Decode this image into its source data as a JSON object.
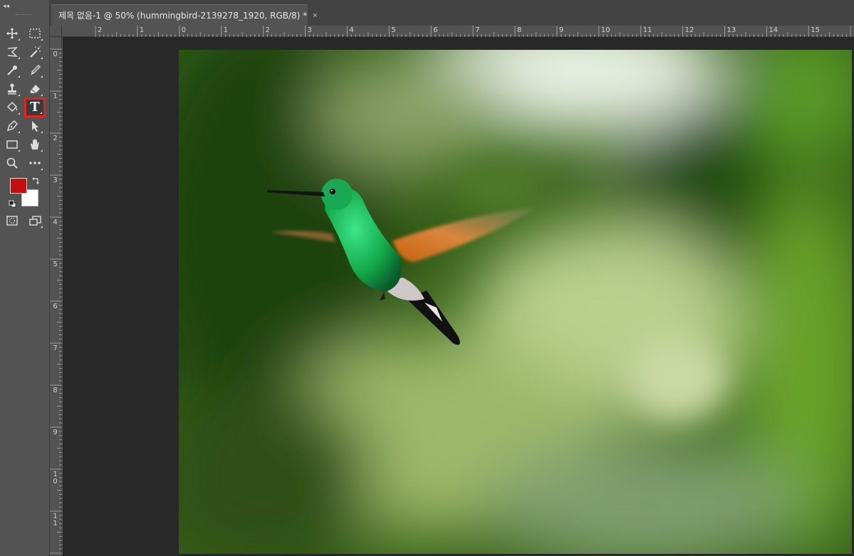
{
  "toolbar": {
    "collapse_label": "◂◂",
    "tools": [
      {
        "id": "move",
        "icon": "move-icon"
      },
      {
        "id": "marquee",
        "icon": "rect-marquee-icon"
      },
      {
        "id": "lasso",
        "icon": "polygonal-lasso-icon"
      },
      {
        "id": "magic-wand",
        "icon": "magic-wand-icon"
      },
      {
        "id": "eyedropper",
        "icon": "eyedropper-icon"
      },
      {
        "id": "brush",
        "icon": "brush-icon"
      },
      {
        "id": "stamp",
        "icon": "clone-stamp-icon"
      },
      {
        "id": "eraser",
        "icon": "eraser-icon"
      },
      {
        "id": "paint-bucket",
        "icon": "paint-bucket-icon"
      },
      {
        "id": "type",
        "icon": "type-icon",
        "label": "T",
        "selected": true
      },
      {
        "id": "pen",
        "icon": "pen-icon"
      },
      {
        "id": "path-selection",
        "icon": "path-selection-icon"
      },
      {
        "id": "rectangle",
        "icon": "rectangle-icon"
      },
      {
        "id": "hand",
        "icon": "hand-icon"
      },
      {
        "id": "zoom",
        "icon": "zoom-icon"
      },
      {
        "id": "more",
        "icon": "more-icon"
      },
      {
        "id": "quick-mask",
        "icon": "quick-mask-icon"
      },
      {
        "id": "screen-mode",
        "icon": "screen-mode-icon"
      }
    ],
    "foreground_color": "#c20e0e",
    "background_color": "#ffffff",
    "selection_color": "#e3231b"
  },
  "document": {
    "tab_title": "제목 없음-1 @ 50% (hummingbird-2139278_1920, RGB/8) *",
    "close_glyph": "×"
  },
  "rulers": {
    "horizontal": [
      "2",
      "1",
      "0",
      "1",
      "2",
      "3",
      "4",
      "5",
      "6",
      "7",
      "8",
      "9",
      "10",
      "11",
      "12",
      "13",
      "14",
      "15"
    ],
    "vertical": [
      "0",
      "1",
      "2",
      "3",
      "4",
      "5",
      "6",
      "7",
      "8",
      "9",
      "10",
      "11"
    ]
  },
  "canvas": {
    "image_subject": "hummingbird-2139278_1920"
  }
}
